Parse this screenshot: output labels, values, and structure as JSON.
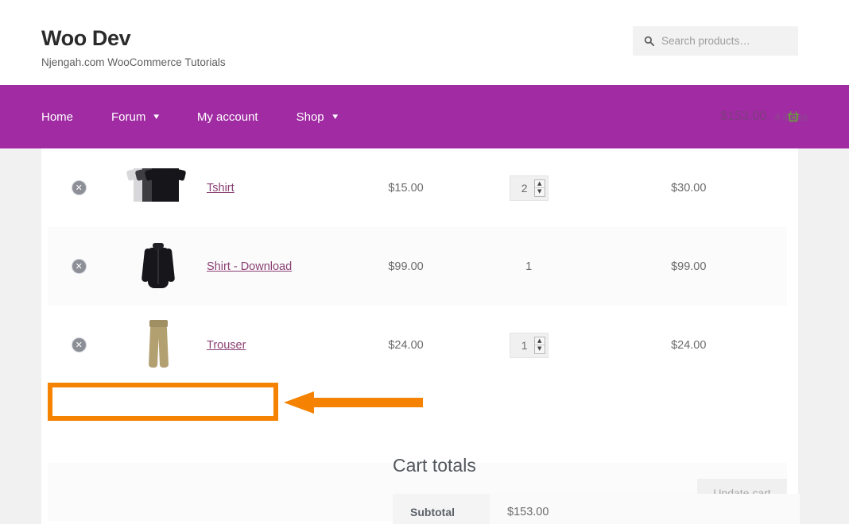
{
  "header": {
    "site_title": "Woo Dev",
    "site_description": "Njengah.com WooCommerce Tutorials",
    "search": {
      "placeholder": "Search products…",
      "value": "",
      "icon": "search-icon"
    }
  },
  "nav": {
    "background_color": "#a02ba3",
    "items": [
      {
        "label": "Home",
        "has_submenu": false
      },
      {
        "label": "Forum",
        "has_submenu": true,
        "chevron": "▾"
      },
      {
        "label": "My account",
        "has_submenu": false
      },
      {
        "label": "Shop",
        "has_submenu": true,
        "chevron": "▾"
      }
    ],
    "cart": {
      "amount": "$153.00",
      "items_count": "4 items",
      "icon": "shopping-basket-icon"
    }
  },
  "cart_table": {
    "rows": [
      {
        "remove_label": "✕",
        "thumbnail": "tshirt-stack-thumbnail",
        "product_name": "Tshirt",
        "price": "$15.00",
        "quantity": "2",
        "quantity_editable": true,
        "subtotal": "$30.00"
      },
      {
        "remove_label": "✕",
        "thumbnail": "black-shirt-thumbnail",
        "product_name": "Shirt - Download",
        "price": "$99.00",
        "quantity": "1",
        "quantity_editable": false,
        "subtotal": "$99.00"
      },
      {
        "remove_label": "✕",
        "thumbnail": "khaki-trouser-thumbnail",
        "product_name": "Trouser",
        "price": "$24.00",
        "quantity": "1",
        "quantity_editable": true,
        "subtotal": "$24.00"
      }
    ]
  },
  "actions": {
    "update_cart_label": "Update cart"
  },
  "annotation": {
    "color": "#f58200",
    "highlight_box_label": "",
    "arrow": "left-pointing-arrow"
  },
  "cart_totals": {
    "title": "Cart totals",
    "rows": [
      {
        "label": "Subtotal",
        "value": "$153.00"
      }
    ]
  }
}
